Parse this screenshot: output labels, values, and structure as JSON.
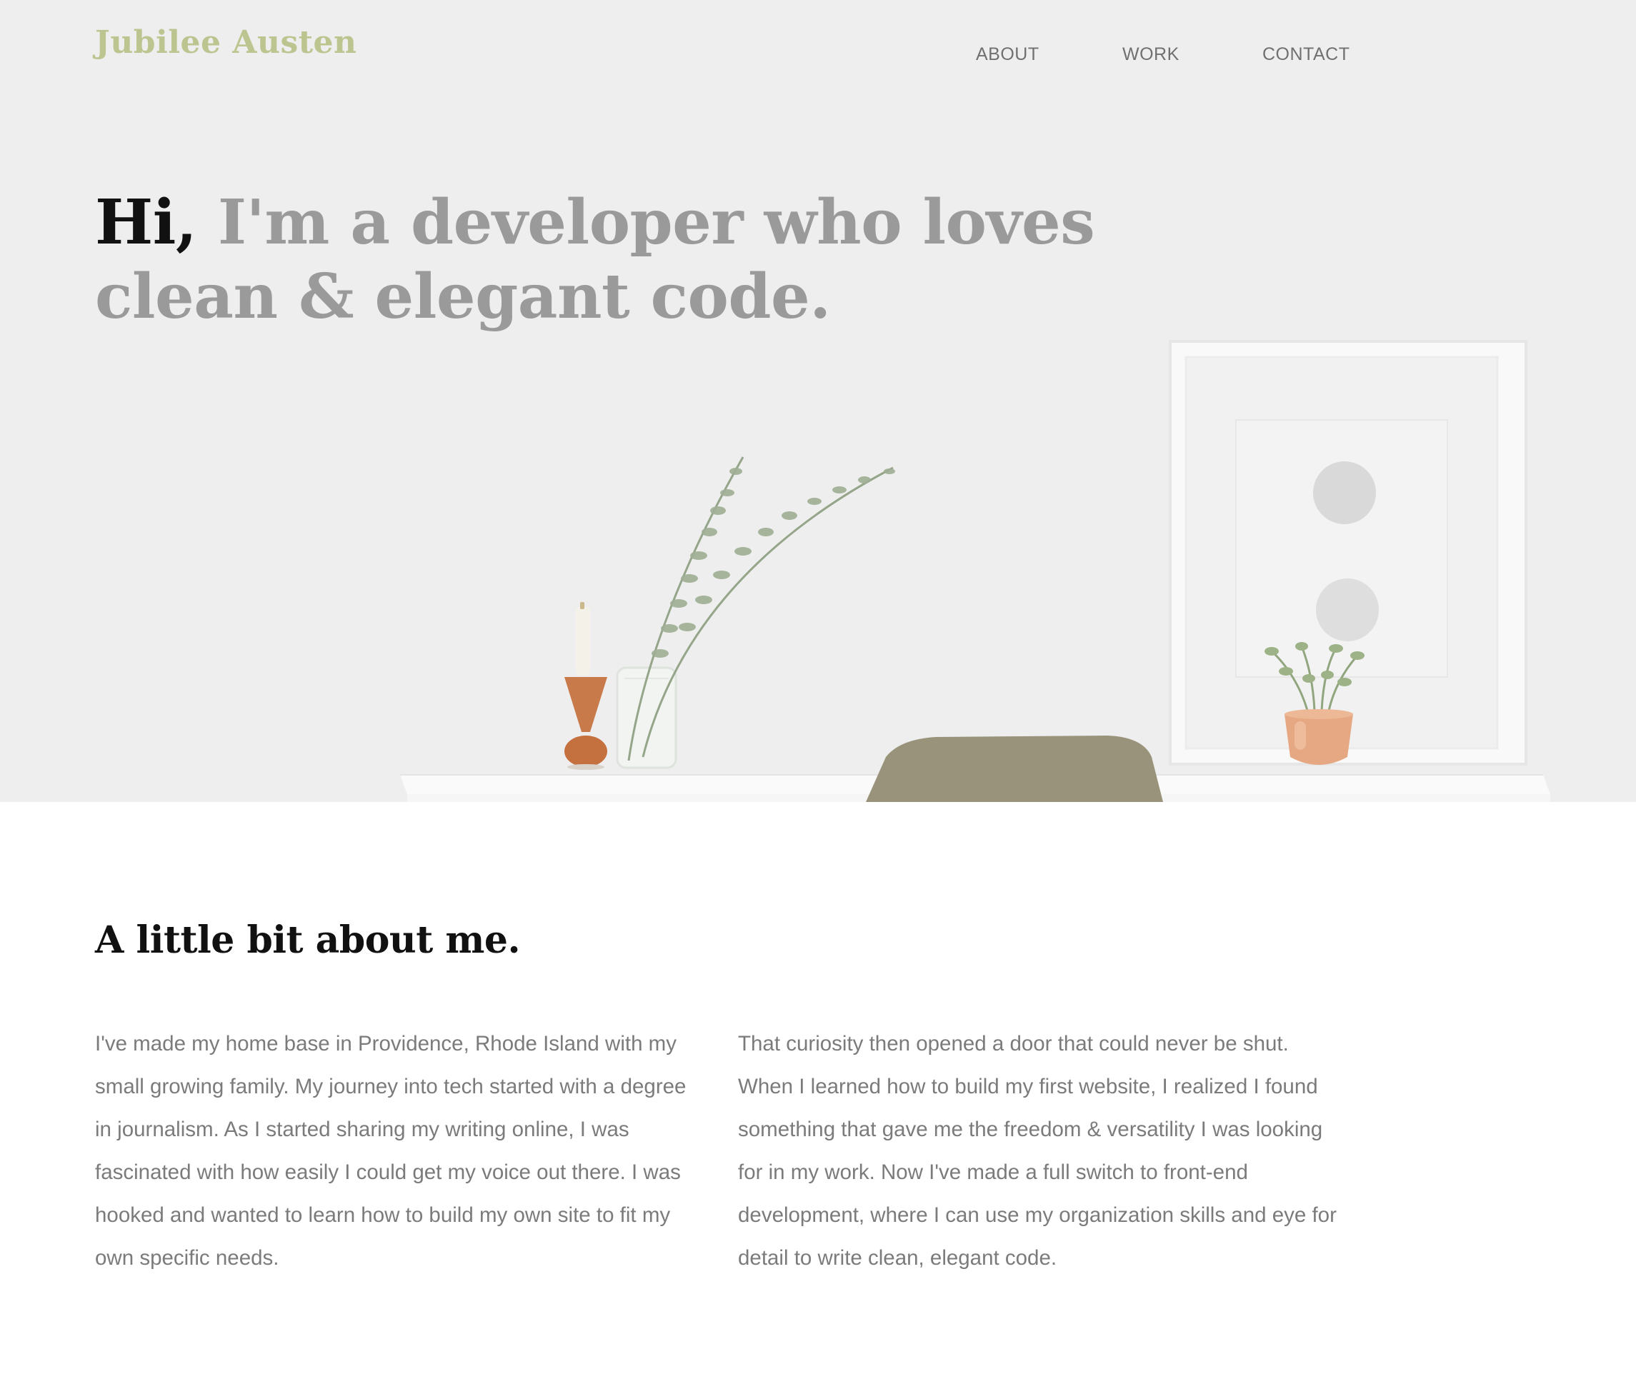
{
  "site": {
    "name": "Jubilee Austen"
  },
  "nav": {
    "items": [
      {
        "label": "ABOUT"
      },
      {
        "label": "WORK"
      },
      {
        "label": "CONTACT"
      }
    ]
  },
  "hero": {
    "greeting": "Hi,",
    "tagline": "I'm a developer who loves clean & elegant code."
  },
  "about": {
    "heading": "A little bit about me.",
    "paragraphs": [
      "I've made my home base in Providence, Rhode Island with my small growing family. My journey into tech started with a degree in journalism. As I started sharing my writing online, I was fascinated with how easily I could get my voice out there. I was hooked and wanted to learn how to build my own site to fit my own specific needs.",
      "That curiosity then opened a door that could never be shut. When I learned how to build my first website, I realized I found something that gave me the freedom & versatility I was looking for in my work. Now I've made a full switch to front-end development, where I can use my organization skills and eye for detail to write clean, elegant code."
    ]
  },
  "colors": {
    "brand": "#bcc58f",
    "heading": "#111111",
    "hero_text": "#9a9a9a",
    "body_text": "#7b7b7b",
    "nav_text": "#707070",
    "hero_background": "#eeeeee"
  }
}
